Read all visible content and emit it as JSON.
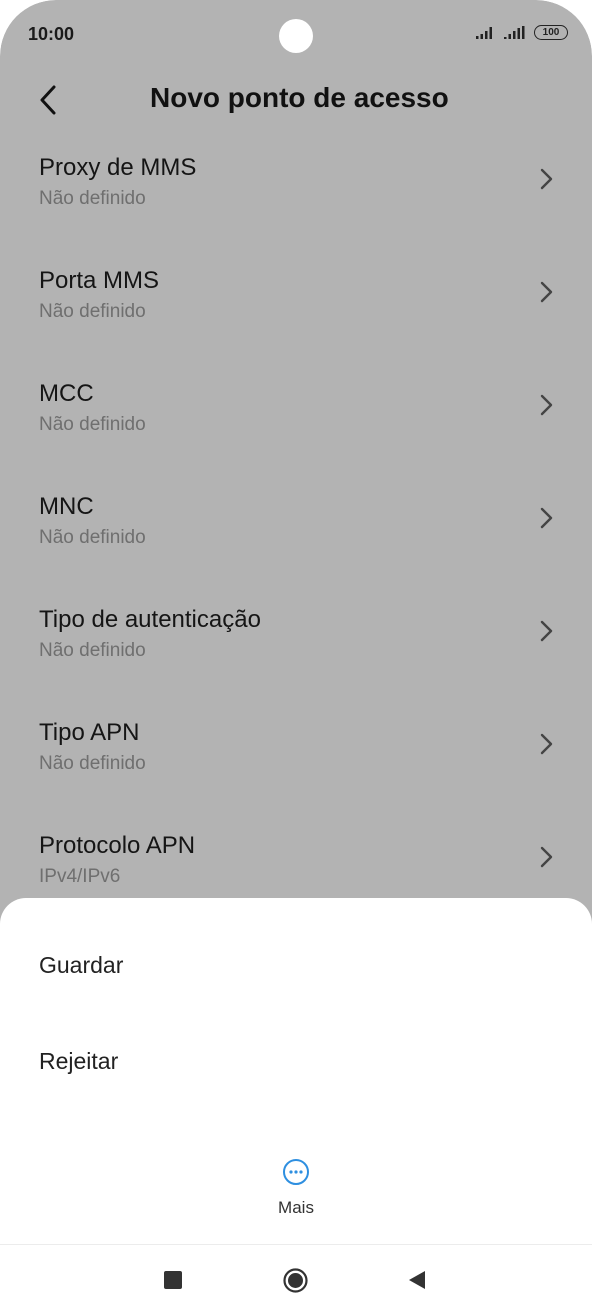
{
  "status_bar": {
    "time": "10:00",
    "battery": "100"
  },
  "header": {
    "title": "Novo ponto de acesso"
  },
  "settings": [
    {
      "title": "Proxy de MMS",
      "value": "Não definido"
    },
    {
      "title": "Porta MMS",
      "value": "Não definido"
    },
    {
      "title": "MCC",
      "value": "Não definido"
    },
    {
      "title": "MNC",
      "value": "Não definido"
    },
    {
      "title": "Tipo de autenticação",
      "value": "Não definido"
    },
    {
      "title": "Tipo APN",
      "value": "Não definido"
    },
    {
      "title": "Protocolo APN",
      "value": "IPv4/IPv6"
    }
  ],
  "menu": {
    "save": "Guardar",
    "discard": "Rejeitar",
    "more": "Mais"
  },
  "colors": {
    "overlay": "#b3b3b3",
    "accent": "#2e8fe0"
  }
}
